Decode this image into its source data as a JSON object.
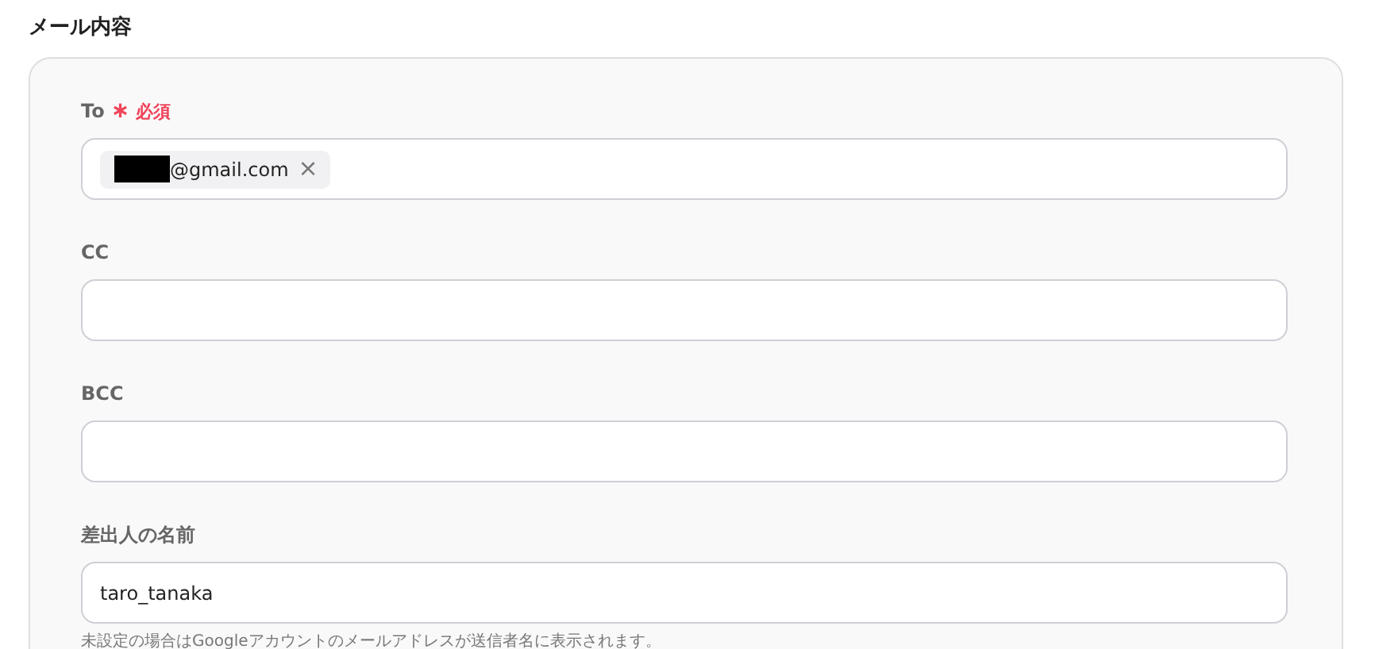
{
  "section_title": "メール内容",
  "fields": [
    {
      "kind": "chips",
      "label": "To",
      "required_mark": "∗",
      "required_text": "必須",
      "chips": [
        {
          "redacted": true,
          "text": "@gmail.com",
          "remove": "×"
        }
      ]
    },
    {
      "kind": "text",
      "label": "CC"
    },
    {
      "kind": "text",
      "label": "BCC"
    },
    {
      "kind": "text",
      "label": "差出人の名前",
      "value": "taro_tanaka",
      "hint": "未設定の場合はGoogleアカウントのメールアドレスが送信者名に表示されます。"
    }
  ]
}
